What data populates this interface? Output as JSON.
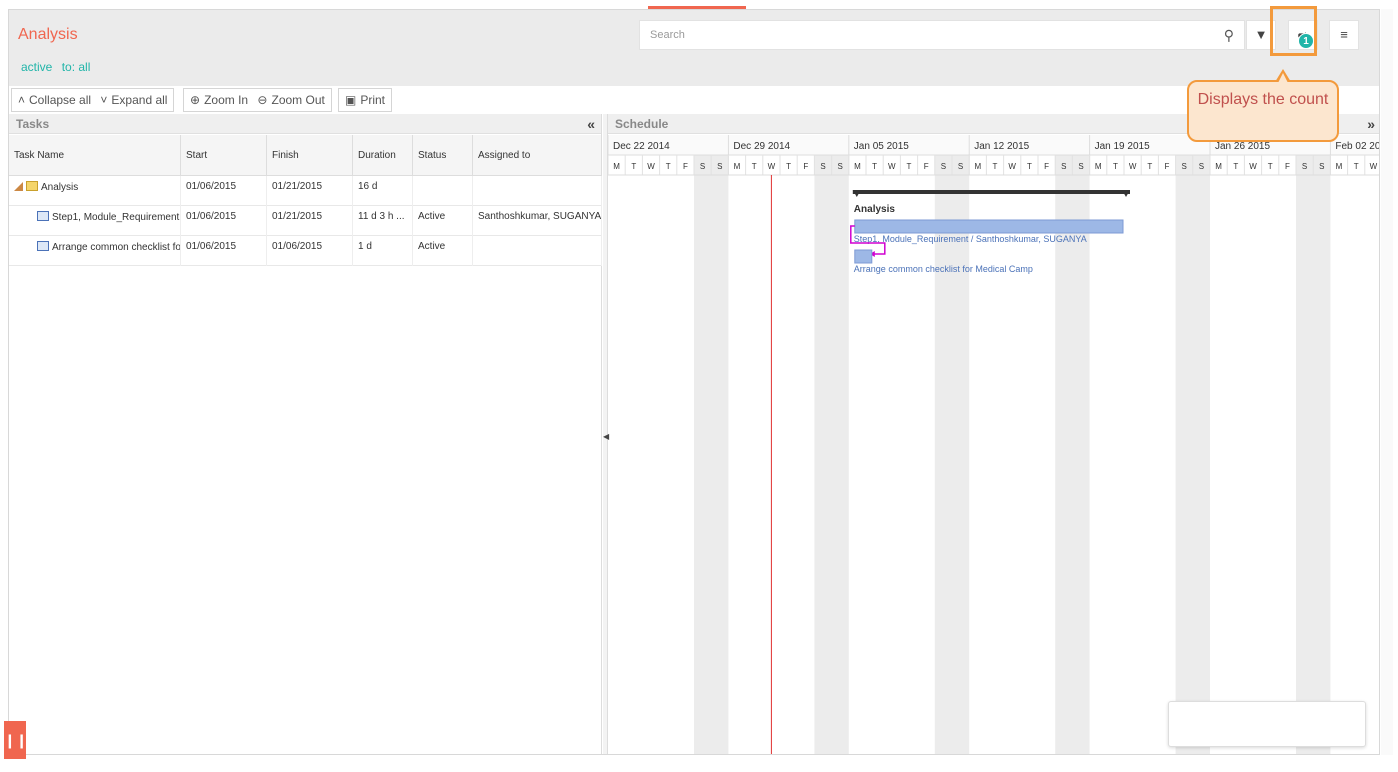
{
  "header": {
    "title": "Analysis",
    "filters": [
      "active",
      "to: all"
    ],
    "search_placeholder": "Search",
    "badge_count": "1",
    "callout": "Displays the count"
  },
  "toolbar": {
    "collapse_all": "Collapse all",
    "expand_all": "Expand all",
    "zoom_in": "Zoom In",
    "zoom_out": "Zoom Out",
    "print": "Print"
  },
  "tasks": {
    "title": "Tasks",
    "columns": [
      "Task Name",
      "Start",
      "Finish",
      "Duration",
      "Status",
      "Assigned to"
    ],
    "rows": [
      {
        "name": "Analysis",
        "start": "01/06/2015",
        "finish": "01/21/2015",
        "duration": "16 d",
        "status": "",
        "assigned": ""
      },
      {
        "name": "Step1, Module_Requirement",
        "start": "01/06/2015",
        "finish": "01/21/2015",
        "duration": "11 d 3 h ...",
        "status": "Active",
        "assigned": "Santhoshkumar, SUGANYA"
      },
      {
        "name": "Arrange common checklist fo",
        "start": "01/06/2015",
        "finish": "01/06/2015",
        "duration": "1 d",
        "status": "Active",
        "assigned": ""
      }
    ]
  },
  "schedule": {
    "title": "Schedule",
    "weeks": [
      "Dec 22 2014",
      "Dec 29 2014",
      "Jan 05 2015",
      "Jan 12 2015",
      "Jan 19 2015",
      "Jan 26 2015",
      "Feb 02 2015"
    ],
    "day_letters": [
      "M",
      "T",
      "W",
      "T",
      "F",
      "S",
      "S"
    ],
    "summary_label": "Analysis",
    "bar1_label": "Step1, Module_Requirement / Santhoshkumar, SUGANYA",
    "bar2_label": "Arrange common checklist for Medical Camp"
  },
  "colors": {
    "accent": "#f0664f",
    "teal": "#21b5a9",
    "bar": "#9db8e6",
    "today_line": "#e03030",
    "link": "#d000d0",
    "callout_border": "#f39a3c"
  }
}
